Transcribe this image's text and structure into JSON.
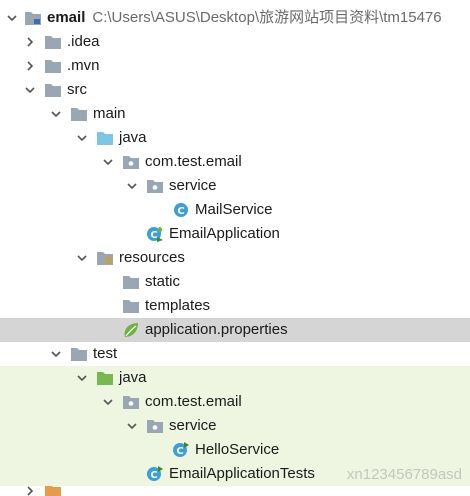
{
  "tree": {
    "root": {
      "name": "email",
      "path": "C:\\Users\\ASUS\\Desktop\\旅游网站项目资料\\tm15476"
    },
    "nodes": [
      {
        "label": ".idea",
        "expanded": false
      },
      {
        "label": ".mvn",
        "expanded": false
      },
      {
        "label": "src",
        "expanded": true
      },
      {
        "label": "main",
        "expanded": true
      },
      {
        "label": "java",
        "expanded": true
      },
      {
        "label": "com.test.email",
        "expanded": true
      },
      {
        "label": "service",
        "expanded": true
      },
      {
        "label": "MailService"
      },
      {
        "label": "EmailApplication"
      },
      {
        "label": "resources",
        "expanded": true
      },
      {
        "label": "static"
      },
      {
        "label": "templates"
      },
      {
        "label": "application.properties",
        "selected": true
      },
      {
        "label": "test",
        "expanded": true
      },
      {
        "label": "java",
        "expanded": true
      },
      {
        "label": "com.test.email",
        "expanded": true
      },
      {
        "label": "service",
        "expanded": true
      },
      {
        "label": "HelloService"
      },
      {
        "label": "EmailApplicationTests"
      }
    ]
  },
  "watermark": "xn123456789asd",
  "colors": {
    "folder": "#9aa7b3",
    "source_folder": "#7fc6e4",
    "test_folder": "#79b753",
    "class_icon": "#3d9fd9",
    "spring_leaf": "#6db33f",
    "selection": "#d5d5d5",
    "test_background": "#eef6e2"
  }
}
